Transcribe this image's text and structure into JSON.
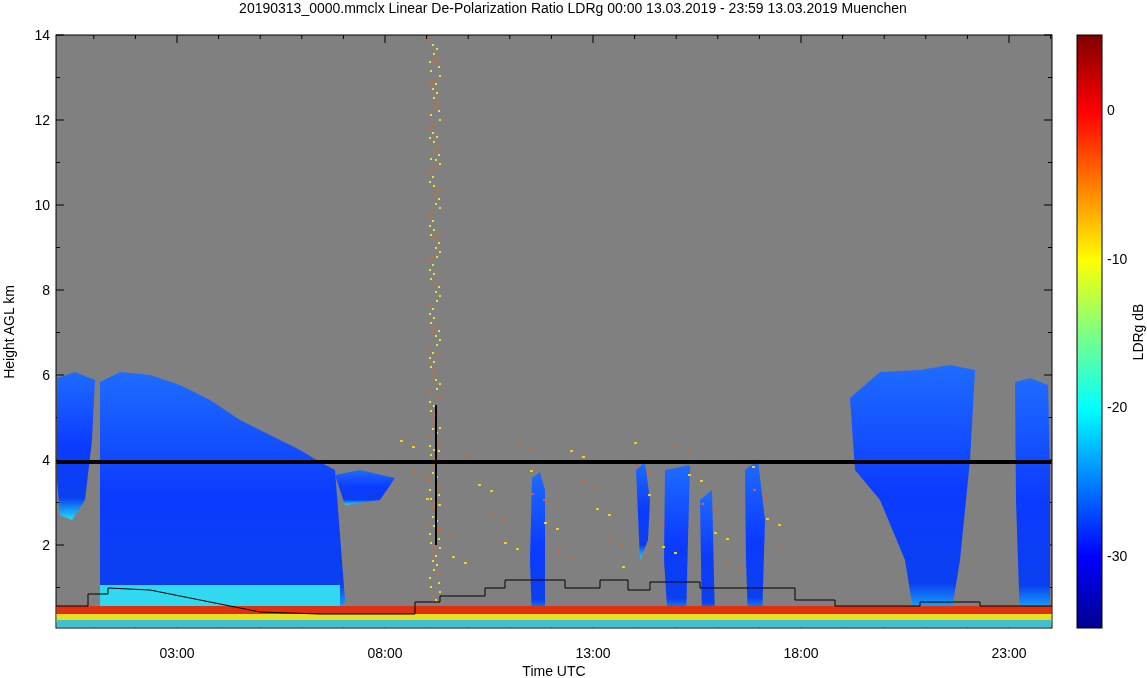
{
  "title": "20190313_0000.mmclx Linear De-Polarization Ratio LDRg   00:00 13.03.2019 - 23:59 13.03.2019 Muenchen",
  "plot": {
    "ylabel": "Height AGL km",
    "xlabel": "Time UTC",
    "yticks": [
      "14",
      "12",
      "10",
      "8",
      "6",
      "4",
      "2"
    ],
    "xticks": [
      "03:00",
      "08:00",
      "13:00",
      "18:00",
      "23:00"
    ]
  },
  "colorbar": {
    "label": "LDRg dB",
    "ticks": [
      "0",
      "-10",
      "-20",
      "-30"
    ]
  }
}
